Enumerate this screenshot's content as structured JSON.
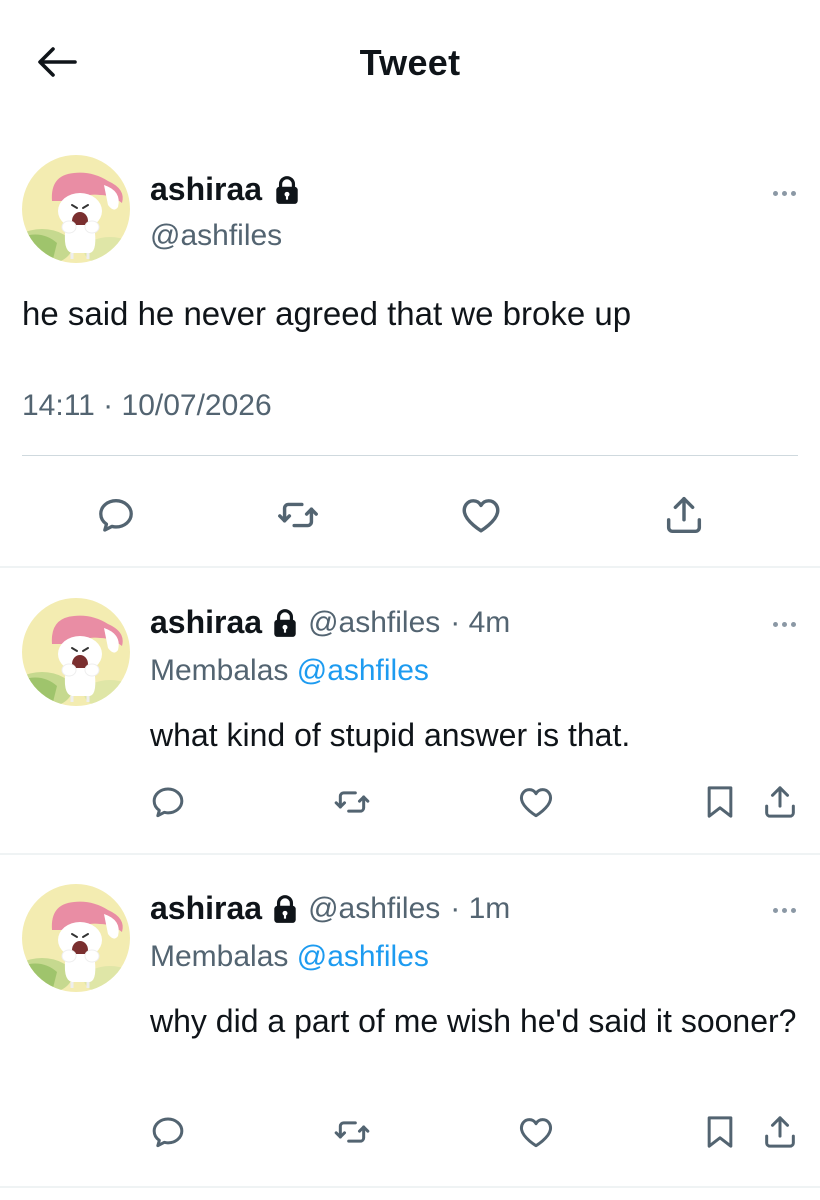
{
  "header": {
    "title": "Tweet",
    "back_icon": "arrow-left-icon"
  },
  "main_tweet": {
    "display_name": "ashiraa",
    "handle": "@ashfiles",
    "locked": true,
    "text": "he said he never agreed that we broke up",
    "timestamp": "14:11 · 10/07/2026",
    "actions": [
      "reply-icon",
      "retweet-icon",
      "like-icon",
      "share-icon"
    ]
  },
  "replies": [
    {
      "display_name": "ashiraa",
      "handle": "@ashfiles",
      "time": "· 4m",
      "replying_label": "Membalas",
      "replying_to": "@ashfiles",
      "text": "what kind of stupid answer is that.",
      "actions": [
        "reply-icon",
        "retweet-icon",
        "like-icon",
        "bookmark-icon",
        "share-icon"
      ]
    },
    {
      "display_name": "ashiraa",
      "handle": "@ashfiles",
      "time": "· 1m",
      "replying_label": "Membalas",
      "replying_to": "@ashfiles",
      "text": "why did a part of me wish he'd said it sooner?",
      "actions": [
        "reply-icon",
        "retweet-icon",
        "like-icon",
        "bookmark-icon",
        "share-icon"
      ]
    }
  ],
  "colors": {
    "text_primary": "#0f1419",
    "text_secondary": "#536471",
    "link": "#1d9bf0",
    "divider": "#eff3f4"
  }
}
